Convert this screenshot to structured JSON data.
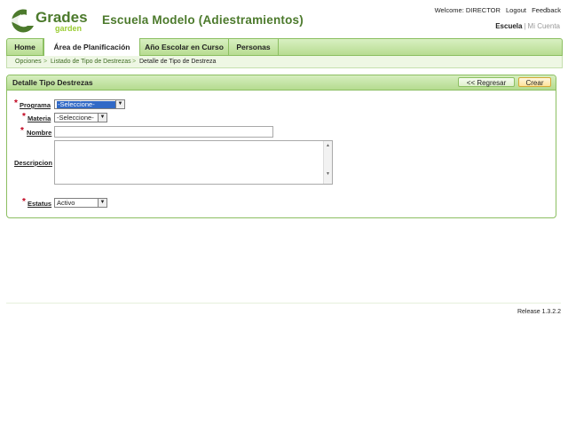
{
  "header": {
    "logo_word": "Grades",
    "logo_sub": "garden",
    "site_title": "Escuela Modelo (Adiestramientos)",
    "welcome": "Welcome: DIRECTOR",
    "logout": "Logout",
    "feedback": "Feedback",
    "account_escuela": "Escuela",
    "account_separator": "|",
    "account_mi": "Mi Cuenta"
  },
  "nav": {
    "tabs": [
      {
        "label": "Home",
        "active": false
      },
      {
        "label": "Área de Planificación",
        "active": true
      },
      {
        "label": "Año Escolar en Curso",
        "active": false
      },
      {
        "label": "Personas",
        "active": false
      }
    ]
  },
  "breadcrumb": {
    "items": [
      "Opciones",
      "Listado de Tipo de Destrezas",
      "Detalle de Tipo de Destreza"
    ],
    "separator": ">"
  },
  "panel": {
    "title": "Detalle Tipo Destrezas",
    "back_label": "<< Regresar",
    "create_label": "Crear"
  },
  "form": {
    "required_mark": "*",
    "programa_label": "Programa",
    "programa_value": "-Seleccione-",
    "materia_label": "Materia",
    "materia_value": "-Seleccione-",
    "nombre_label": "Nombre",
    "nombre_value": "",
    "descripcion_label": "Descripcion",
    "descripcion_value": "",
    "estatus_label": "Estatus",
    "estatus_value": "Activo"
  },
  "footer": {
    "release": "Release 1.3.2.2"
  },
  "colors": {
    "brand_green": "#4c7a2c",
    "nav_green": "#b7dc91",
    "required_red": "#c0001c",
    "create_button": "#ffe29a"
  }
}
